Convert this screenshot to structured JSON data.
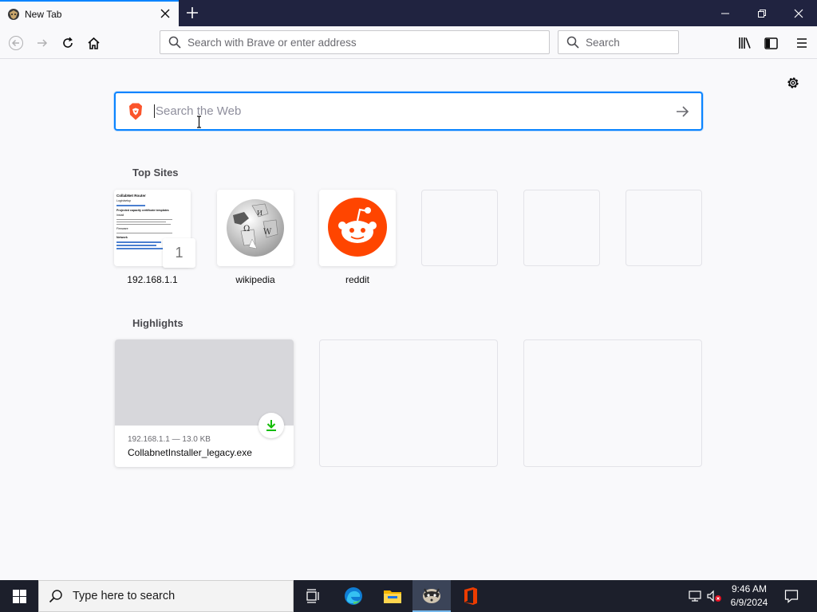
{
  "tab": {
    "title": "New Tab"
  },
  "toolbar": {
    "url_placeholder": "Search with Brave or enter address",
    "search_placeholder": "Search"
  },
  "newtab": {
    "search_placeholder": "Search the Web",
    "top_sites_title": "Top Sites",
    "top_sites": [
      {
        "label": "192.168.1.1",
        "pin_number": "1",
        "thumb_lines": [
          "CollabNet Router",
          "Login/setup",
          "Projected capacity certificate templates",
          "Install",
          "Firmware",
          "Network"
        ]
      },
      {
        "label": "wikipedia",
        "icon": "wikipedia-globe-icon"
      },
      {
        "label": "reddit",
        "icon": "reddit-icon"
      },
      {
        "label": ""
      },
      {
        "label": ""
      },
      {
        "label": ""
      }
    ],
    "highlights_title": "Highlights",
    "highlights": [
      {
        "meta": "192.168.1.1 — 13.0 KB",
        "filename": "CollabnetInstaller_legacy.exe",
        "icon": "download-icon"
      }
    ]
  },
  "taskbar": {
    "search_placeholder": "Type here to search",
    "time": "9:46 AM",
    "date": "6/9/2024"
  },
  "colors": {
    "titlebar": "#202340",
    "accent": "#0a84ff",
    "reddit": "#ff4500",
    "brave": "#fb542b",
    "download_green": "#12bc00"
  }
}
